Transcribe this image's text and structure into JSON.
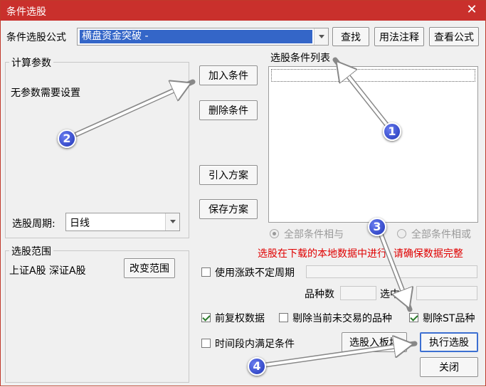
{
  "window": {
    "title": "条件选股",
    "close_glyph": "✕"
  },
  "formula": {
    "label": "条件选股公式",
    "selected": "横盘资金突破 -"
  },
  "buttons": {
    "find": "查找",
    "usage": "用法注释",
    "view_formula": "查看公式",
    "add_condition": "加入条件",
    "delete_condition": "删除条件",
    "import_plan": "引入方案",
    "save_plan": "保存方案",
    "change_range": "改变范围",
    "select_to_board": "选股入板块",
    "execute": "执行选股",
    "close": "关闭"
  },
  "params": {
    "group_title": "计算参数",
    "no_params": "无参数需要设置",
    "period_label": "选股周期:",
    "period_value": "日线"
  },
  "range": {
    "group_title": "选股范围",
    "markets": "上证A股  深证A股"
  },
  "conditions": {
    "list_label": "选股条件列表",
    "radio_and": "全部条件相与",
    "radio_or": "全部条件相或"
  },
  "notice": "选股在下载的本地数据中进行, 请确保数据完整",
  "options": {
    "use_variable_period": "使用涨跌不定周期",
    "count_label": "品种数",
    "selected_label": "选中数",
    "pre_adjust": "前复权数据",
    "exclude_untraded": "剔除当前未交易的品种",
    "exclude_st": "剔除ST品种",
    "time_range": "时间段内满足条件"
  },
  "markers": [
    "1",
    "2",
    "3",
    "4"
  ]
}
